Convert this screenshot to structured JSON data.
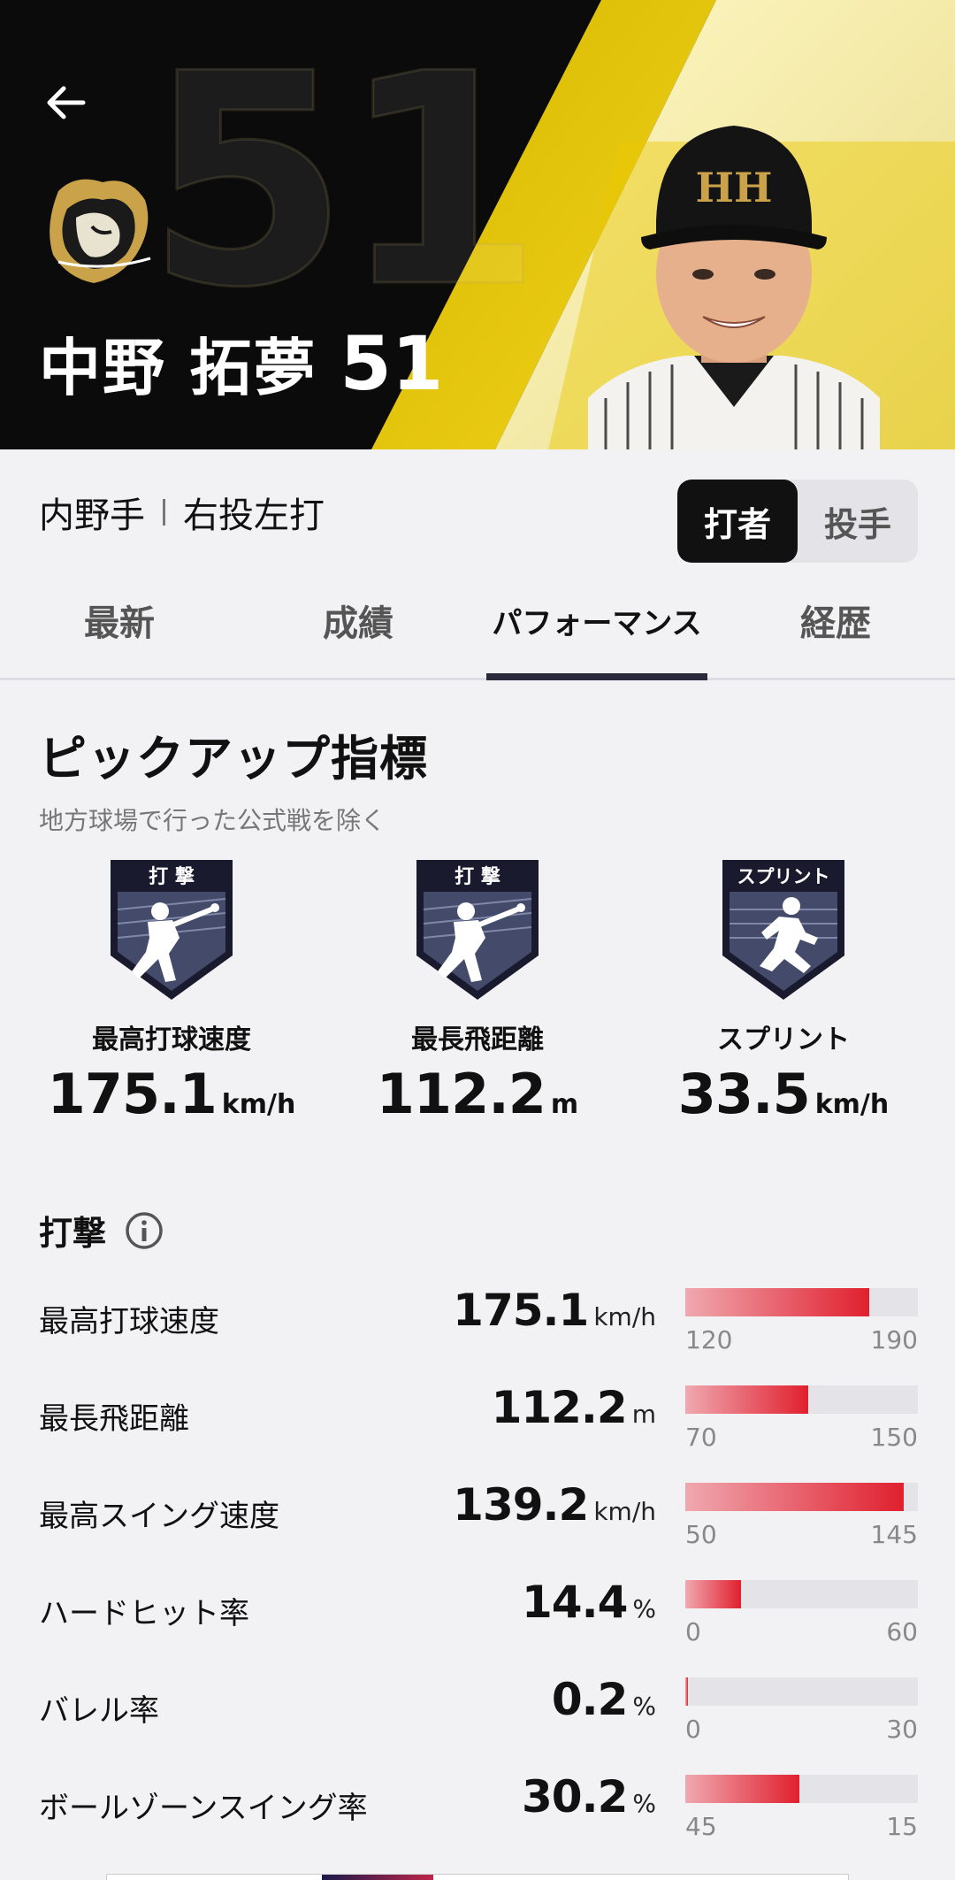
{
  "player": {
    "name": "中野 拓夢",
    "number": "51",
    "bg_number": "51",
    "position": "内野手",
    "throws_bats": "右投左打"
  },
  "toggle": {
    "batter": "打者",
    "pitcher": "投手"
  },
  "tabs": [
    "最新",
    "成績",
    "パフォーマンス",
    "経歴"
  ],
  "pickup": {
    "title": "ピックアップ指標",
    "subtitle": "地方球場で行った公式戦を除く",
    "cards": [
      {
        "badge": "打 撃",
        "label": "最高打球速度",
        "value": "175.1",
        "unit": "km/h",
        "icon": "batter-icon"
      },
      {
        "badge": "打 撃",
        "label": "最長飛距離",
        "value": "112.2",
        "unit": "m",
        "icon": "batter-icon"
      },
      {
        "badge": "スプリント",
        "label": "スプリント",
        "value": "33.5",
        "unit": "km/h",
        "icon": "runner-icon"
      }
    ]
  },
  "batting": {
    "title": "打撃",
    "rows": [
      {
        "label": "最高打球速度",
        "value": "175.1",
        "unit": "km/h",
        "min": "120",
        "max": "190",
        "fill": 0.79
      },
      {
        "label": "最長飛距離",
        "value": "112.2",
        "unit": "m",
        "min": "70",
        "max": "150",
        "fill": 0.53
      },
      {
        "label": "最高スイング速度",
        "value": "139.2",
        "unit": "km/h",
        "min": "50",
        "max": "145",
        "fill": 0.94
      },
      {
        "label": "ハードヒット率",
        "value": "14.4",
        "unit": "%",
        "min": "0",
        "max": "60",
        "fill": 0.24
      },
      {
        "label": "バレル率",
        "value": "0.2",
        "unit": "%",
        "min": "0",
        "max": "30",
        "fill": 0.01
      },
      {
        "label": "ボールゾーンスイング率",
        "value": "30.2",
        "unit": "%",
        "min": "45",
        "max": "15",
        "fill": 0.49
      }
    ]
  },
  "colors": {
    "accent": "#e0202e",
    "gold": "#e8cc1a"
  }
}
